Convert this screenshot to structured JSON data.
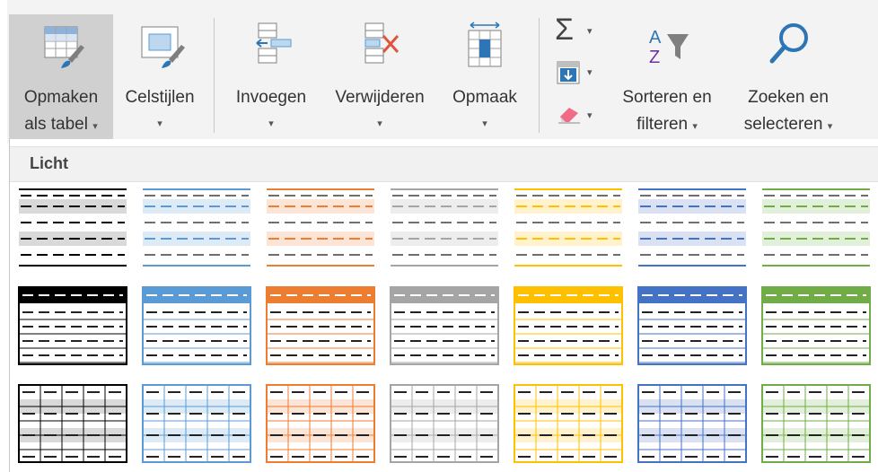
{
  "ribbon": {
    "format_as_table": {
      "line1": "Opmaken",
      "line2": "als tabel",
      "caret": "▾"
    },
    "cell_styles": {
      "line1": "Celstijlen",
      "caret": "▾"
    },
    "insert": {
      "line1": "Invoegen",
      "caret": "▾"
    },
    "delete": {
      "line1": "Verwijderen",
      "caret": "▾"
    },
    "format": {
      "line1": "Opmaak",
      "caret": "▾"
    },
    "autosum": {
      "symbol": "Σ",
      "caret": "▾"
    },
    "fill": {
      "caret": "▾"
    },
    "clear": {
      "caret": "▾"
    },
    "sort_filter": {
      "line1": "Sorteren en",
      "line2": "filteren",
      "caret": "▾"
    },
    "find_select": {
      "line1": "Zoeken en",
      "line2": "selecteren",
      "caret": "▾"
    }
  },
  "gallery": {
    "section_label": "Licht",
    "row_styles": [
      "light-banded",
      "light-header",
      "light-grid"
    ],
    "colors": [
      {
        "name": "black",
        "accent": "#000000",
        "tint": "#d9d9d9"
      },
      {
        "name": "blue",
        "accent": "#5b9bd5",
        "tint": "#ddebf7"
      },
      {
        "name": "orange",
        "accent": "#ed7d31",
        "tint": "#fce4d6"
      },
      {
        "name": "gray",
        "accent": "#a5a5a5",
        "tint": "#ededed"
      },
      {
        "name": "gold",
        "accent": "#ffc000",
        "tint": "#fff2cc"
      },
      {
        "name": "navy",
        "accent": "#4472c4",
        "tint": "#d9e1f2"
      },
      {
        "name": "green",
        "accent": "#70ad47",
        "tint": "#e2efda"
      }
    ]
  }
}
